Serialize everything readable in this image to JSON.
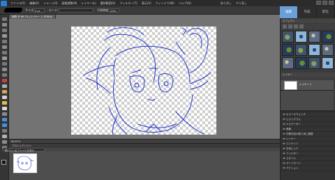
{
  "app": {
    "menus": [
      "ファイル(F)",
      "編集(E)",
      "イメージ(I)",
      "画質調整(N)",
      "レイヤー(L)",
      "選択範囲(S)",
      "フィルター(T)",
      "表示(V)",
      "ウィンドウ(W)",
      "ヘルプ(H)"
    ],
    "undo_label": "取り消し",
    "redo_label": "やり直し",
    "accent_color": "#6a9fd8"
  },
  "options": {
    "size_label": "サイズ:",
    "size_value": "9 px",
    "mode_label": "モード:",
    "opacity_label": "不透明度:",
    "opacity_value": "100%"
  },
  "document": {
    "tab_label": "無題 @ 66.7% (レイヤー 1, RGB/8)",
    "zoom": "66.67%"
  },
  "bin": {
    "label": "プロジェクトビン",
    "select_value": "開いているファイルを表示"
  },
  "panels": {
    "tabs": [
      "編集",
      "作成",
      "配信"
    ],
    "effects_title": "エフェクト",
    "layers_title": "レイヤー",
    "layer_name": "レイヤー 1",
    "rows": [
      "カラースウォッチ",
      "ヒストグラム",
      "ナビゲーター",
      "情報",
      "作業内容の取り消し履歴",
      "レイヤー",
      "コンテンツ",
      "お気に入り",
      "フィルター",
      "スタイル",
      "オートモード",
      "アクション"
    ]
  }
}
